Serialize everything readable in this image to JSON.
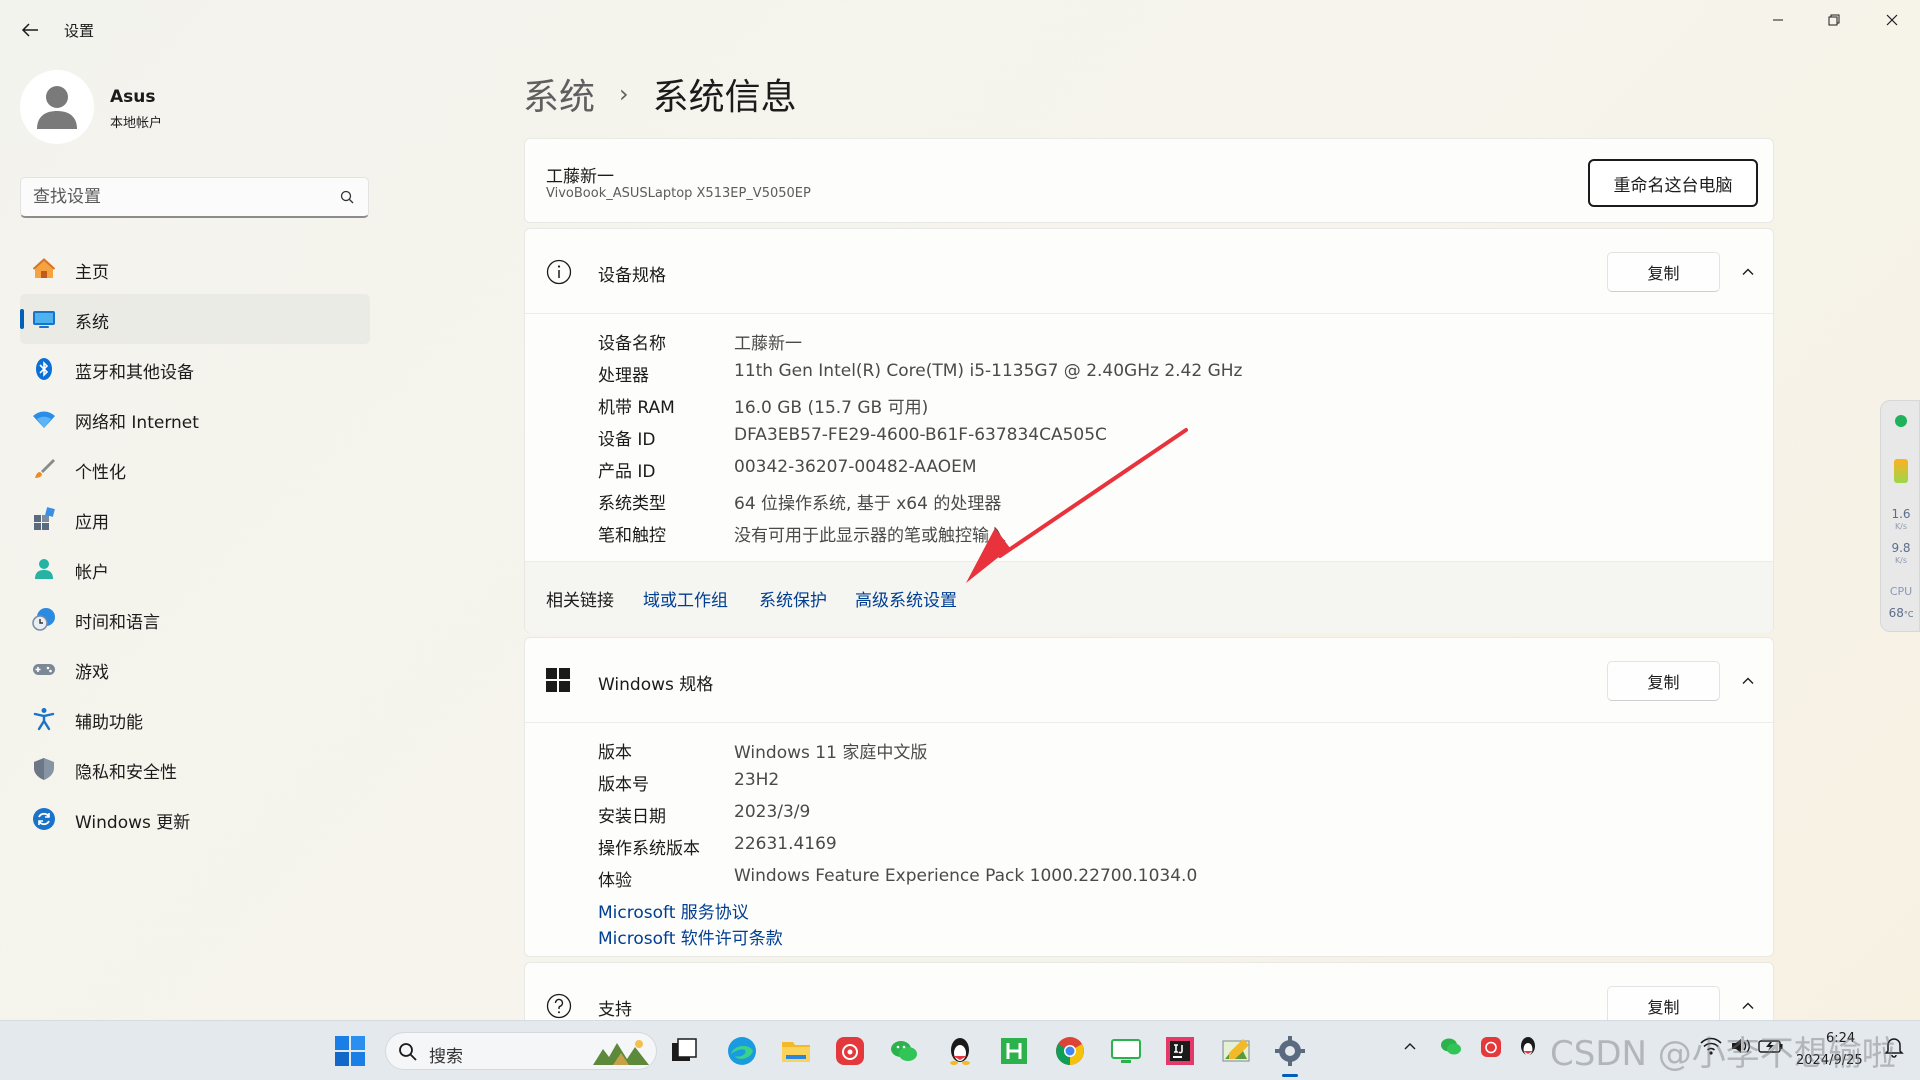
{
  "window": {
    "app_title": "设置"
  },
  "user": {
    "name": "Asus",
    "account_type": "本地帐户"
  },
  "search": {
    "placeholder": "查找设置"
  },
  "sidebar": {
    "items": [
      {
        "label": "主页",
        "icon": "home-icon",
        "active": false
      },
      {
        "label": "系统",
        "icon": "system-icon",
        "active": true
      },
      {
        "label": "蓝牙和其他设备",
        "icon": "bluetooth-icon",
        "active": false
      },
      {
        "label": "网络和 Internet",
        "icon": "wifi-icon",
        "active": false
      },
      {
        "label": "个性化",
        "icon": "brush-icon",
        "active": false
      },
      {
        "label": "应用",
        "icon": "apps-icon",
        "active": false
      },
      {
        "label": "帐户",
        "icon": "account-icon",
        "active": false
      },
      {
        "label": "时间和语言",
        "icon": "clock-globe-icon",
        "active": false
      },
      {
        "label": "游戏",
        "icon": "gamepad-icon",
        "active": false
      },
      {
        "label": "辅助功能",
        "icon": "accessibility-icon",
        "active": false
      },
      {
        "label": "隐私和安全性",
        "icon": "shield-icon",
        "active": false
      },
      {
        "label": "Windows 更新",
        "icon": "update-icon",
        "active": false
      }
    ]
  },
  "breadcrumb": {
    "parent": "系统",
    "separator": "›",
    "current": "系统信息"
  },
  "pc": {
    "name": "工藤新一",
    "model": "VivoBook_ASUSLaptop X513EP_V5050EP",
    "rename_label": "重命名这台电脑"
  },
  "device_specs": {
    "title": "设备规格",
    "copy_label": "复制",
    "rows": [
      {
        "label": "设备名称",
        "value": "工藤新一"
      },
      {
        "label": "处理器",
        "value": "11th Gen Intel(R) Core(TM) i5-1135G7 @ 2.40GHz   2.42 GHz"
      },
      {
        "label": "机带 RAM",
        "value": "16.0 GB (15.7 GB 可用)"
      },
      {
        "label": "设备 ID",
        "value": "DFA3EB57-FE29-4600-B61F-637834CA505C"
      },
      {
        "label": "产品 ID",
        "value": "00342-36207-00482-AAOEM"
      },
      {
        "label": "系统类型",
        "value": "64 位操作系统, 基于 x64 的处理器"
      },
      {
        "label": "笔和触控",
        "value": "没有可用于此显示器的笔或触控输入"
      }
    ]
  },
  "related_links": {
    "label": "相关链接",
    "links": [
      "域或工作组",
      "系统保护",
      "高级系统设置"
    ]
  },
  "windows_specs": {
    "title": "Windows 规格",
    "copy_label": "复制",
    "rows": [
      {
        "label": "版本",
        "value": "Windows 11 家庭中文版"
      },
      {
        "label": "版本号",
        "value": "23H2"
      },
      {
        "label": "安装日期",
        "value": "2023/3/9"
      },
      {
        "label": "操作系统版本",
        "value": "22631.4169"
      },
      {
        "label": "体验",
        "value": "Windows Feature Experience Pack 1000.22700.1034.0"
      }
    ],
    "links": [
      "Microsoft 服务协议",
      "Microsoft 软件许可条款"
    ]
  },
  "support": {
    "title": "支持",
    "copy_label": "复制"
  },
  "widget": {
    "upload": "1.6",
    "upload_unit": "K/s",
    "download": "9.8",
    "download_unit": "K/s",
    "cpu_label": "CPU",
    "cpu_temp": "68",
    "temp_unit": "°C"
  },
  "taskbar": {
    "search_label": "搜索",
    "time": "6:24",
    "date": "2024/9/25",
    "watermark": "CSDN @小李不想输啦"
  },
  "colors": {
    "accent": "#005fb8",
    "link": "#003e92",
    "annotation_arrow": "#e8323c"
  }
}
